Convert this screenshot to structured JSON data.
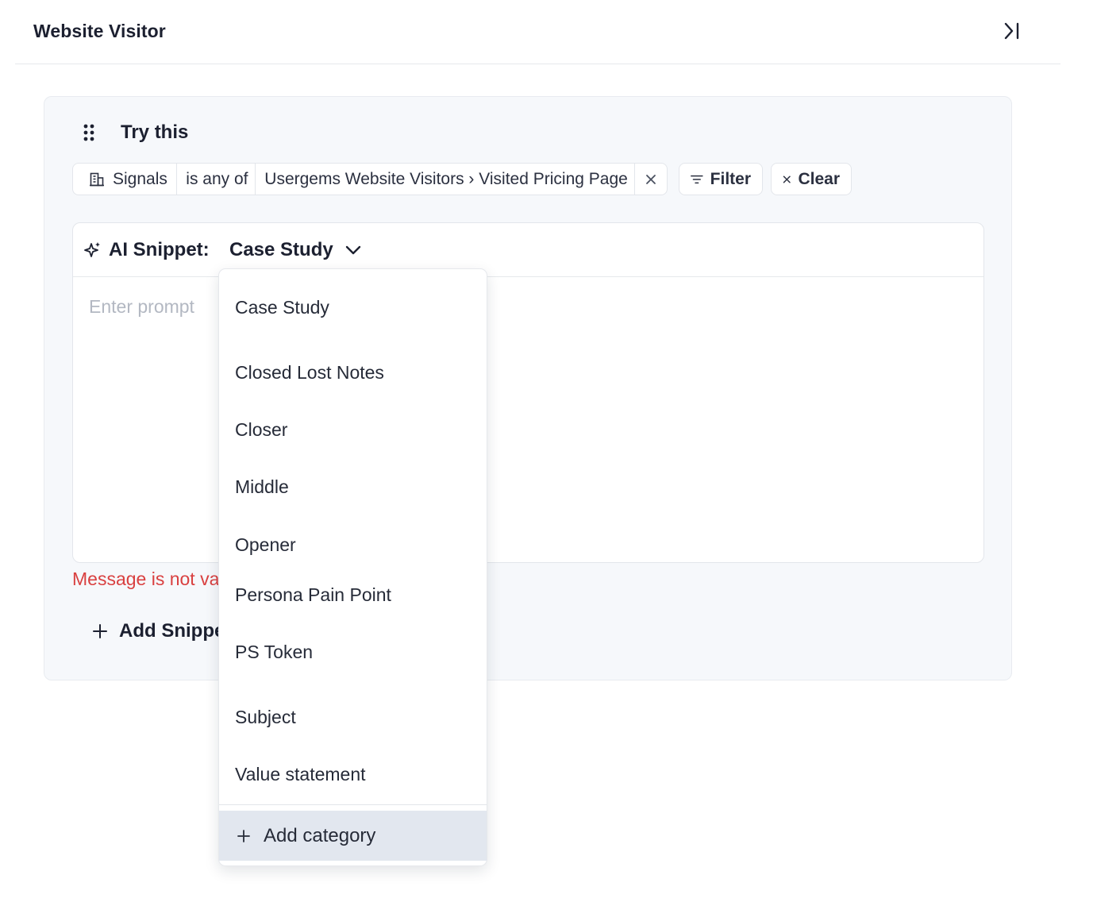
{
  "header": {
    "title": "Website Visitor",
    "collapse_icon": "collapse-right-icon"
  },
  "card": {
    "title": "Try this",
    "filter": {
      "field": "Signals",
      "operator": "is any of",
      "value": "Usergems Website Visitors › Visited Pricing Page"
    },
    "filter_button": "Filter",
    "clear_button": "Clear",
    "snippet": {
      "label": "AI Snippet:",
      "selected_category": "Case Study",
      "prompt_placeholder": "Enter prompt",
      "prompt_value": ""
    },
    "error": "Message is not valid",
    "add_snippet": "Add Snippet"
  },
  "dropdown": {
    "items": [
      "Case Study",
      "Closed Lost Notes",
      "Closer",
      "Middle",
      "Opener",
      "Persona Pain Point",
      "PS Token",
      "Subject",
      "Value statement"
    ],
    "add_label": "Add category"
  },
  "colors": {
    "error": "#d94040",
    "card_bg": "#f6f8fb",
    "highlight": "#e2e7ef",
    "text": "#1c2030"
  }
}
